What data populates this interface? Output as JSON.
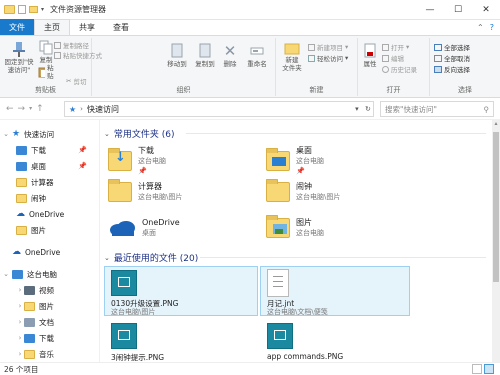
{
  "window": {
    "title": "文件资源管理器",
    "controls": {
      "minimize": "—",
      "maximize": "☐",
      "close": "✕"
    }
  },
  "tabs": [
    "文件",
    "主页",
    "共享",
    "查看"
  ],
  "ribbon": {
    "clipboard": {
      "label": "剪贴板",
      "pin": "固定到\"快速访问\"",
      "copy": "复制",
      "paste": "粘贴",
      "cut": "剪切",
      "copy_path": "复制路径",
      "paste_shortcut": "粘贴快捷方式"
    },
    "organize": {
      "label": "组织",
      "move_to": "移动到",
      "copy_to": "复制到",
      "delete": "删除",
      "rename": "重命名"
    },
    "new": {
      "label": "新建",
      "new_folder": "新建\n文件夹",
      "new_item": "新建项目",
      "easy_access": "轻松访问"
    },
    "open": {
      "label": "打开",
      "properties": "属性",
      "open": "打开",
      "edit": "编辑",
      "history": "历史记录"
    },
    "select": {
      "label": "选择",
      "select_all": "全部选择",
      "select_none": "全部取消",
      "invert": "反向选择"
    }
  },
  "address": {
    "breadcrumb": "快速访问",
    "search_placeholder": "搜索\"快速访问\""
  },
  "sidebar": {
    "items": [
      {
        "label": "快速访问",
        "icon": "star-icon",
        "color": "#2b7fd1",
        "expanded": true
      },
      {
        "label": "下载",
        "icon": "download-folder-icon",
        "color": "#3a87d6",
        "pinned": true
      },
      {
        "label": "桌面",
        "icon": "desktop-folder-icon",
        "color": "#3a87d6",
        "pinned": true
      },
      {
        "label": "计算器",
        "icon": "folder-icon",
        "color": "#f8d775"
      },
      {
        "label": "闹钟",
        "icon": "folder-icon",
        "color": "#f8d775"
      },
      {
        "label": "OneDrive",
        "icon": "onedrive-icon",
        "color": "#1d63b8"
      },
      {
        "label": "图片",
        "icon": "pictures-folder-icon",
        "color": "#f8d775"
      },
      {
        "label": "OneDrive",
        "icon": "onedrive-icon",
        "color": "#1d63b8"
      },
      {
        "label": "这台电脑",
        "icon": "computer-icon",
        "color": "#3a87d6"
      },
      {
        "label": "视频",
        "icon": "videos-folder-icon",
        "color": "#5b6c7d"
      },
      {
        "label": "图片",
        "icon": "pictures-folder-icon",
        "color": "#f8d775"
      },
      {
        "label": "文档",
        "icon": "documents-folder-icon",
        "color": "#8b9db3"
      },
      {
        "label": "下载",
        "icon": "download-folder-icon",
        "color": "#3a87d6"
      },
      {
        "label": "音乐",
        "icon": "music-folder-icon",
        "color": "#f8d775"
      }
    ]
  },
  "frequent": {
    "header": "常用文件夹 (6)",
    "items": [
      {
        "name": "下载",
        "location": "这台电脑",
        "pinned": true,
        "icon": "download-folder-icon"
      },
      {
        "name": "桌面",
        "location": "这台电脑",
        "pinned": true,
        "icon": "desktop-folder-icon"
      },
      {
        "name": "计算器",
        "location": "这台电脑\\图片",
        "pinned": false,
        "icon": "folder-icon"
      },
      {
        "name": "闹钟",
        "location": "这台电脑\\图片",
        "pinned": false,
        "icon": "folder-icon"
      },
      {
        "name": "OneDrive",
        "location": "桌面",
        "pinned": false,
        "icon": "onedrive-icon"
      },
      {
        "name": "图片",
        "location": "这台电脑",
        "pinned": false,
        "icon": "pictures-folder-icon"
      }
    ],
    "pin_glyph": "📌"
  },
  "recent": {
    "header": "最近使用的文件 (20)",
    "items": [
      {
        "name": "0130升级设置.PNG",
        "location": "这台电脑\\图片",
        "selected": true,
        "icon": "image-file-icon"
      },
      {
        "name": "月记.jnt",
        "location": "这台电脑\\文档\\便笺",
        "selected": true,
        "icon": "journal-file-icon"
      },
      {
        "name": "3闹钟提示.PNG",
        "location": "",
        "selected": false,
        "icon": "image-file-icon"
      },
      {
        "name": "app commands.PNG",
        "location": "",
        "selected": false,
        "icon": "image-file-icon"
      }
    ]
  },
  "status": {
    "count": "26 个项目"
  }
}
